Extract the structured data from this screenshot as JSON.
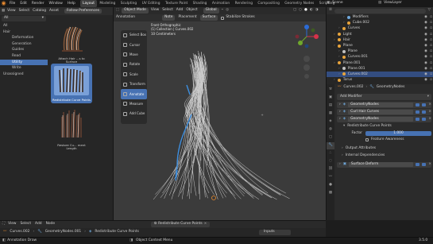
{
  "topbar": {
    "menus": [
      "File",
      "Edit",
      "Render",
      "Window",
      "Help"
    ],
    "workspaces": [
      "Layout",
      "Modeling",
      "Sculpting",
      "UV Editing",
      "Texture Paint",
      "Shading",
      "Animation",
      "Rendering",
      "Compositing",
      "Geometry Nodes",
      "Scripting"
    ],
    "active_workspace": "Layout",
    "scene": "Scene",
    "view_layer": "ViewLayer"
  },
  "asset_browser": {
    "header": [
      "View",
      "Select",
      "Catalog",
      "Asset"
    ],
    "library": "All",
    "import_method": "Follow Preferences",
    "tree": [
      {
        "label": "All",
        "sub": false,
        "sel": false
      },
      {
        "label": "Hair",
        "sub": false,
        "sel": false
      },
      {
        "label": "Deformation",
        "sub": true,
        "sel": false
      },
      {
        "label": "Generation",
        "sub": true,
        "sel": false
      },
      {
        "label": "Guides",
        "sub": true,
        "sel": false
      },
      {
        "label": "Read",
        "sub": true,
        "sel": false
      },
      {
        "label": "Utility",
        "sub": true,
        "sel": true
      },
      {
        "label": "Write",
        "sub": true,
        "sel": false
      },
      {
        "label": "Unassigned",
        "sub": false,
        "sel": false
      }
    ],
    "assets": [
      {
        "label": "Attach Hair ...s to Surface"
      },
      {
        "label": "Redistribute Curve Points"
      },
      {
        "label": "Restore Cu... ment Length"
      }
    ]
  },
  "viewport": {
    "mode": "Object Mode",
    "header_menus": [
      "View",
      "Select",
      "Add",
      "Object"
    ],
    "orientation": "Global",
    "annotation_label": "Annotation",
    "placement_label": "Placement",
    "surface_label": "Surface",
    "stabilize_label": "Stabilize Strokes",
    "note_label": "Note",
    "info_line1": "Front Orthographic",
    "info_line2": "(1) Collection | Curves.002",
    "info_line3": "10 Centimeters",
    "tools": [
      "Select Box",
      "Cursor",
      "Move",
      "Rotate",
      "Scale",
      "Transform",
      "Annotate",
      "Measure",
      "Add Cube"
    ],
    "active_tool": "Annotate",
    "gizmo_labels": [
      "Z",
      "X",
      "Y"
    ]
  },
  "outliner": {
    "items": [
      {
        "label": "Modifiers",
        "indent": 3,
        "color": "#6fa8dc",
        "sel": false
      },
      {
        "label": "Cube.002",
        "indent": 3,
        "color": "#e8a43c",
        "sel": false
      },
      {
        "label": "Curves",
        "indent": 2,
        "color": "#e8a43c",
        "sel": false
      },
      {
        "label": "Light",
        "indent": 1,
        "color": "#e8a43c",
        "sel": false
      },
      {
        "label": "Hair",
        "indent": 1,
        "color": "#e8a43c",
        "sel": false
      },
      {
        "label": "Plane",
        "indent": 1,
        "color": "#e8a43c",
        "sel": false
      },
      {
        "label": "Plane",
        "indent": 2,
        "color": "#c2c2c2",
        "sel": false
      },
      {
        "label": "Curves.001",
        "indent": 2,
        "color": "#e8a43c",
        "sel": false
      },
      {
        "label": "Plane.001",
        "indent": 1,
        "color": "#e8a43c",
        "sel": false
      },
      {
        "label": "Plane.001",
        "indent": 2,
        "color": "#c2c2c2",
        "sel": false
      },
      {
        "label": "Curves.002",
        "indent": 2,
        "color": "#e8a43c",
        "sel": true
      },
      {
        "label": "Torus",
        "indent": 1,
        "color": "#e8a43c",
        "sel": false
      }
    ]
  },
  "properties": {
    "object_name": "Curves.002",
    "modifier_tab": "GeometryNodes",
    "add_modifier": "Add Modifier",
    "modifiers": [
      "GeometryNodes",
      "Curl Hair Curves",
      "GeometryNodes"
    ],
    "redistribute": "Redistribute Curve Points",
    "factor_label": "Factor",
    "factor_value": "1.000",
    "feature_awareness": "Feature Awareness",
    "output_attributes": "Output Attributes",
    "internal_dependencies": "Internal Dependencies",
    "surface_deform": "Surface Deform"
  },
  "node_editor": {
    "menus": [
      "View",
      "Select",
      "Add",
      "Node"
    ],
    "object": "Curves.002",
    "modifier": "GeometryNodes.001",
    "breadcrumb": "Redistribute Curve Points",
    "pill_label": "Inputs"
  },
  "status": {
    "left": "Annotation Draw",
    "middle": "Object Context Menu",
    "version": "3.5.0"
  },
  "colors": {
    "accent": "#4772b3",
    "curve_white": "#e8e8e8",
    "annotation_blue": "#3d8fe0"
  }
}
